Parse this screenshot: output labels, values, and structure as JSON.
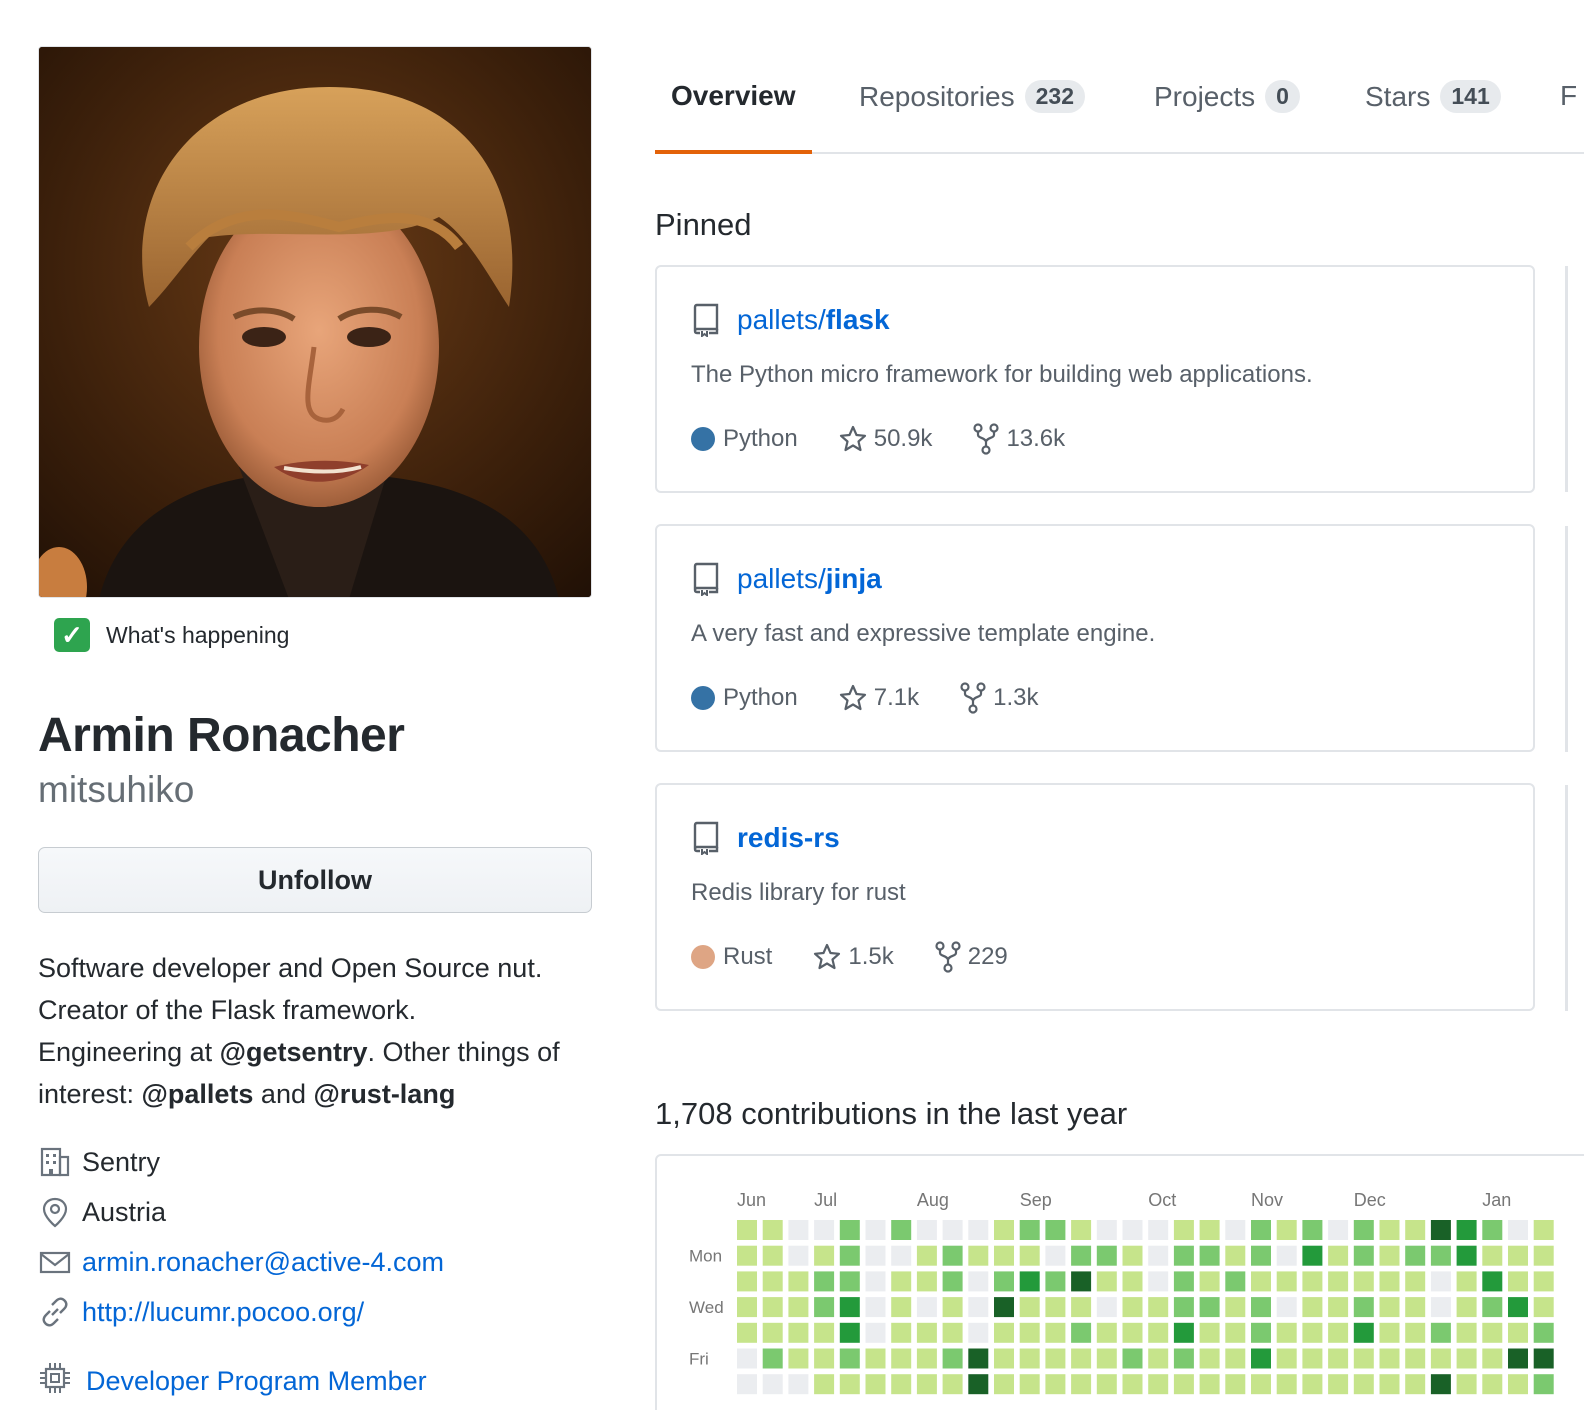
{
  "profile": {
    "status_text": "What's happening",
    "full_name": "Armin Ronacher",
    "username": "mitsuhiko",
    "follow_button": "Unfollow",
    "bio": {
      "line1": "Software developer and Open Source nut.",
      "line2": "Creator of the Flask framework.",
      "line3_prefix": "Engineering at ",
      "mention_sentry": "@getsentry",
      "line3_suffix": ". Other things of",
      "line4_prefix": "interest: ",
      "mention_pallets": "@pallets",
      "and": " and ",
      "mention_rust": "@rust-lang"
    },
    "company": "Sentry",
    "location": "Austria",
    "email": "armin.ronacher@active-4.com",
    "website": "http://lucumr.pocoo.org/",
    "badge": "Developer Program Member"
  },
  "tabs": [
    {
      "label": "Overview",
      "count": null,
      "active": true
    },
    {
      "label": "Repositories",
      "count": "232"
    },
    {
      "label": "Projects",
      "count": "0"
    },
    {
      "label": "Stars",
      "count": "141"
    }
  ],
  "pinned": {
    "title": "Pinned",
    "repos": [
      {
        "owner": "pallets/",
        "name": "flask",
        "description": "The Python micro framework for building web applications.",
        "language": "Python",
        "language_color": "#3572A5",
        "stars": "50.9k",
        "forks": "13.6k"
      },
      {
        "owner": "pallets/",
        "name": "jinja",
        "description": "A very fast and expressive template engine.",
        "language": "Python",
        "language_color": "#3572A5",
        "stars": "7.1k",
        "forks": "1.3k"
      },
      {
        "owner": "",
        "name": "redis-rs",
        "description": "Redis library for rust",
        "language": "Rust",
        "language_color": "#dea584",
        "stars": "1.5k",
        "forks": "229"
      }
    ]
  },
  "contributions": {
    "title": "1,708 contributions in the last year",
    "months": [
      "Jun",
      "Jul",
      "Aug",
      "Sep",
      "Oct",
      "Nov",
      "Dec",
      "Jan"
    ],
    "days": [
      "Mon",
      "Wed",
      "Fri"
    ],
    "colors": [
      "#ebedf0",
      "#c6e48b",
      "#7bc96f",
      "#239a3b",
      "#196127"
    ],
    "weeks": [
      [
        1,
        1,
        1,
        1,
        1,
        0,
        0
      ],
      [
        1,
        1,
        1,
        1,
        1,
        2,
        0
      ],
      [
        0,
        0,
        1,
        1,
        1,
        1,
        0
      ],
      [
        0,
        1,
        2,
        2,
        1,
        1,
        1
      ],
      [
        2,
        2,
        2,
        3,
        3,
        2,
        1
      ],
      [
        0,
        0,
        0,
        0,
        0,
        1,
        1
      ],
      [
        2,
        0,
        1,
        1,
        1,
        1,
        1
      ],
      [
        0,
        1,
        1,
        0,
        1,
        1,
        1
      ],
      [
        0,
        2,
        2,
        1,
        1,
        2,
        1
      ],
      [
        0,
        1,
        0,
        0,
        0,
        4,
        4
      ],
      [
        1,
        1,
        2,
        4,
        1,
        1,
        1
      ],
      [
        2,
        1,
        3,
        1,
        1,
        1,
        1
      ],
      [
        2,
        0,
        2,
        1,
        1,
        1,
        1
      ],
      [
        1,
        2,
        4,
        1,
        2,
        1,
        1
      ],
      [
        0,
        2,
        1,
        0,
        1,
        1,
        1
      ],
      [
        0,
        1,
        1,
        1,
        1,
        2,
        1
      ],
      [
        0,
        0,
        0,
        1,
        1,
        1,
        1
      ],
      [
        1,
        2,
        2,
        2,
        3,
        2,
        1
      ],
      [
        1,
        2,
        1,
        2,
        1,
        1,
        1
      ],
      [
        0,
        1,
        2,
        1,
        1,
        1,
        1
      ],
      [
        2,
        2,
        1,
        2,
        2,
        3,
        1
      ],
      [
        1,
        0,
        1,
        0,
        1,
        1,
        1
      ],
      [
        2,
        3,
        1,
        1,
        1,
        1,
        1
      ],
      [
        0,
        1,
        1,
        1,
        1,
        1,
        1
      ],
      [
        2,
        2,
        1,
        2,
        3,
        1,
        1
      ],
      [
        1,
        1,
        1,
        1,
        1,
        1,
        1
      ],
      [
        1,
        2,
        1,
        1,
        1,
        1,
        1
      ],
      [
        4,
        2,
        0,
        0,
        2,
        1,
        4
      ],
      [
        3,
        3,
        1,
        1,
        1,
        1,
        1
      ],
      [
        2,
        1,
        3,
        2,
        1,
        1,
        1
      ],
      [
        0,
        1,
        1,
        3,
        1,
        4,
        1
      ],
      [
        1,
        1,
        1,
        1,
        2,
        4,
        2
      ]
    ]
  }
}
